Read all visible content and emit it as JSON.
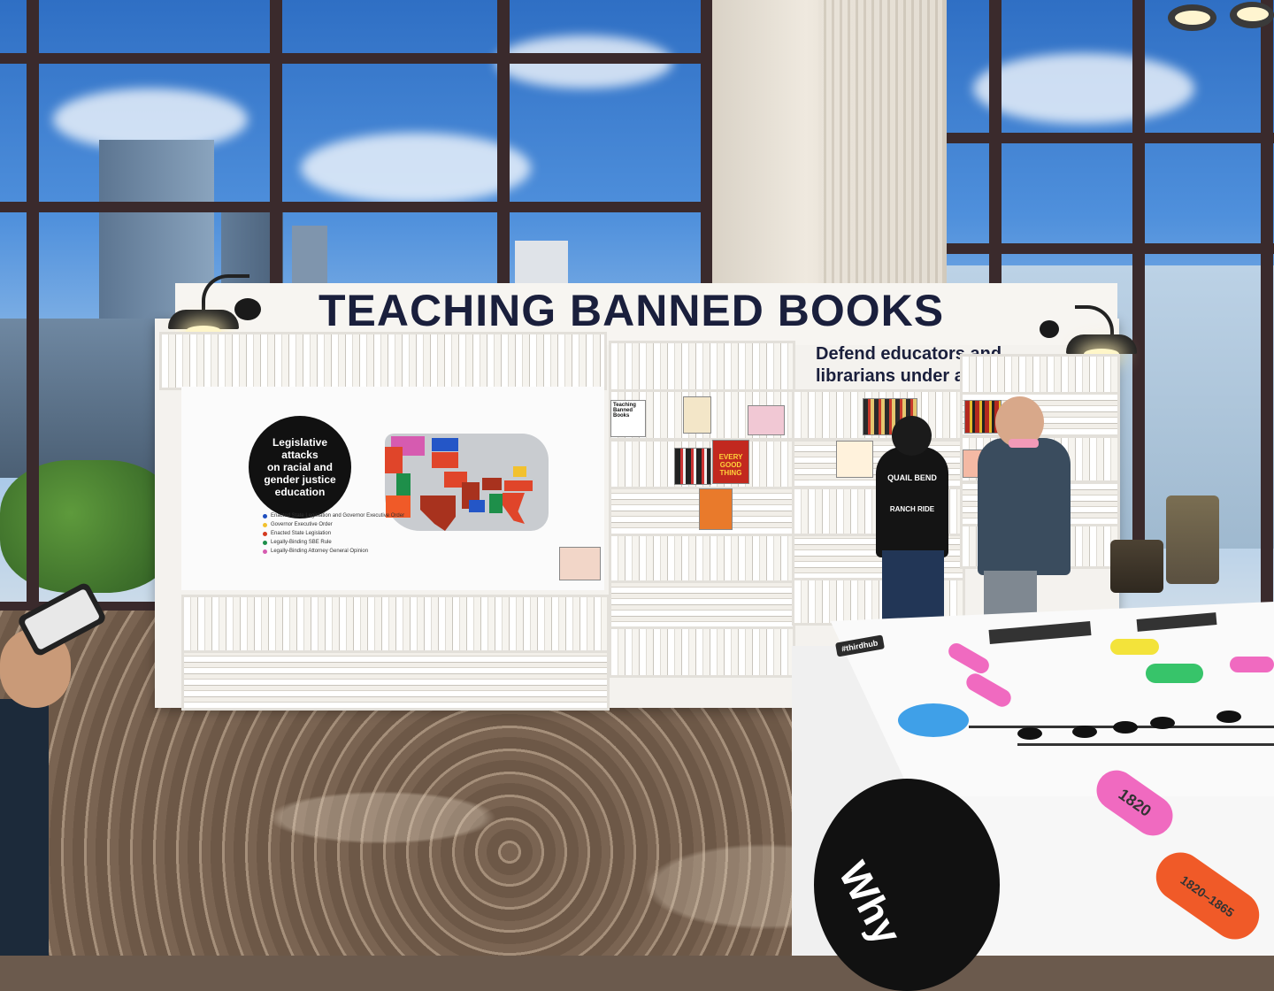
{
  "exhibit": {
    "title": "TEACHING BANNED BOOKS",
    "subtitle_line1": "Defend educators and",
    "subtitle_line2": "librarians under attack"
  },
  "map_panel": {
    "badge_line1": "Legislative",
    "badge_line2": "attacks",
    "badge_line3": "on racial and",
    "badge_line4": "gender justice",
    "badge_line5": "education",
    "legend": [
      {
        "label": "Enacted State Legislation and Governor Executive Order",
        "color": "#1f4fbf"
      },
      {
        "label": "Governor Executive Order",
        "color": "#f2c12e"
      },
      {
        "label": "Enacted State Legislation",
        "color": "#d43a1f"
      },
      {
        "label": "Legally-Binding SBE Rule",
        "color": "#1e8f4a"
      },
      {
        "label": "Legally-Binding Attorney General Opinion",
        "color": "#d65bb0"
      }
    ],
    "state_colors": {
      "red": "#e0452a",
      "dark_red": "#a8321e",
      "orange": "#f05a28",
      "blue": "#2456c7",
      "green": "#1e8f4a",
      "pink": "#d65bb0",
      "yellow": "#f2c12e",
      "gray": "#c9ccd0"
    }
  },
  "shelf_covers": {
    "cover_text": "EVERY GOOD THING",
    "shelf_label": "Teaching Banned Books"
  },
  "table": {
    "card_left": "#thirdhub",
    "year_1": "1820",
    "year_range": "1820–1865",
    "big_text": "Why"
  },
  "person": {
    "shirt_text_line1": "QUAIL BEND",
    "shirt_text_line2": "RANCH RIDE"
  }
}
